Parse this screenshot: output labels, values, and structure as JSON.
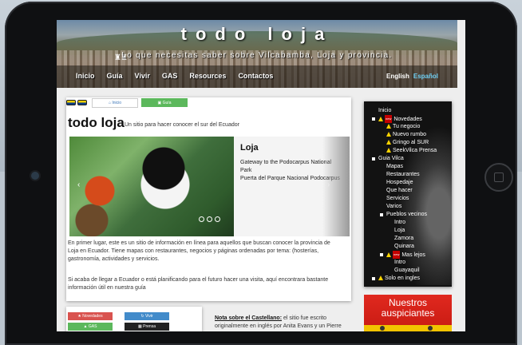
{
  "header": {
    "site_title": "todo loja",
    "tagline": "Lo que necesitas saber sobre Vilcabamba, Loja y provincia.",
    "nav": [
      "Inicio",
      "Guía",
      "Vivir",
      "GAS",
      "Resources",
      "Contactos"
    ],
    "lang_en": "English",
    "lang_es": "Español"
  },
  "main": {
    "tab_inicio": "Inicio",
    "tab_guia": "Guía",
    "title": "todo loja",
    "subtitle": "Un sitio para hacer conocer el sur del Ecuador",
    "slide": {
      "title": "Loja",
      "line1": "Gateway to the Podocarpus National Park",
      "line2": "Puerta del Parque Nacional Podocarpus"
    },
    "para1": "En primer lugar, este es un sitio de información en línea para aquellos que buscan conocer la provincia de Loja en Ecuador. Tiene mapas con restaurantes, negocios y páginas ordenadas por tema: (hosterías, gastronomía, actividades y servicios.",
    "para2": "Si acaba de llegar a Ecuador o está planificando para el futuro hacer una visita, aquí encontrara bastante información útil en nuestra guía"
  },
  "bottom": {
    "btn_novedades": "Novedades",
    "btn_vivir": "Vivir",
    "btn_gas": "GAS",
    "btn_prensa": "Prensa",
    "note_label": "Nota sobre el Castellano:",
    "note_text": " el sitio fue escrito originalmente en inglés por Anita Evans y un  Pierre"
  },
  "sidebar": {
    "items": [
      "Inicio",
      "Novedades",
      "Tu negocio",
      "Nuevo rumbo",
      "Gringo al SUR",
      "SeekVilca Prensa",
      "Guia Vilca",
      "Mapas",
      "Restaurantes",
      "Hospedaje",
      "Que hacer",
      "Servicios",
      "Varios",
      "Pueblos vecinos",
      "Intro",
      "Loja",
      "Zamora",
      "Quinara",
      "Mas lejos",
      "Intro",
      "Guayaquil",
      "Solo en ingles"
    ],
    "new_badge": "new"
  },
  "ad": {
    "title": "Nuestros auspiciantes"
  },
  "colors": {
    "accent_blue": "#428bca",
    "accent_green": "#5cb85c",
    "accent_red": "#d9534f",
    "lang_active": "#6fd0f5"
  }
}
